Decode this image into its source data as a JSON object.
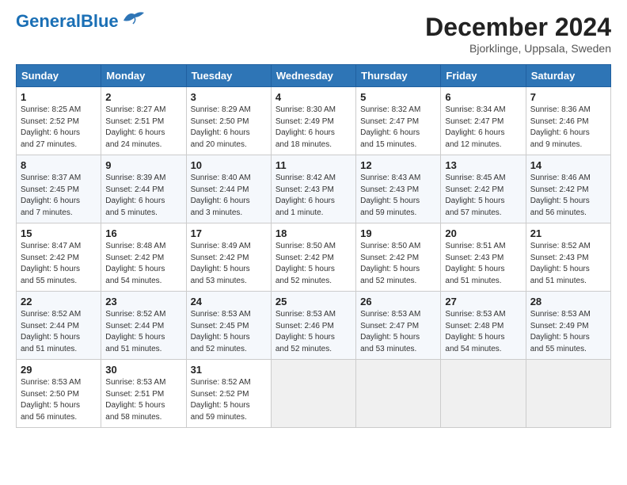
{
  "header": {
    "logo_general": "General",
    "logo_blue": "Blue",
    "title": "December 2024",
    "subtitle": "Bjorklinge, Uppsala, Sweden"
  },
  "calendar": {
    "columns": [
      "Sunday",
      "Monday",
      "Tuesday",
      "Wednesday",
      "Thursday",
      "Friday",
      "Saturday"
    ],
    "weeks": [
      [
        {
          "day": "1",
          "details": "Sunrise: 8:25 AM\nSunset: 2:52 PM\nDaylight: 6 hours\nand 27 minutes."
        },
        {
          "day": "2",
          "details": "Sunrise: 8:27 AM\nSunset: 2:51 PM\nDaylight: 6 hours\nand 24 minutes."
        },
        {
          "day": "3",
          "details": "Sunrise: 8:29 AM\nSunset: 2:50 PM\nDaylight: 6 hours\nand 20 minutes."
        },
        {
          "day": "4",
          "details": "Sunrise: 8:30 AM\nSunset: 2:49 PM\nDaylight: 6 hours\nand 18 minutes."
        },
        {
          "day": "5",
          "details": "Sunrise: 8:32 AM\nSunset: 2:47 PM\nDaylight: 6 hours\nand 15 minutes."
        },
        {
          "day": "6",
          "details": "Sunrise: 8:34 AM\nSunset: 2:47 PM\nDaylight: 6 hours\nand 12 minutes."
        },
        {
          "day": "7",
          "details": "Sunrise: 8:36 AM\nSunset: 2:46 PM\nDaylight: 6 hours\nand 9 minutes."
        }
      ],
      [
        {
          "day": "8",
          "details": "Sunrise: 8:37 AM\nSunset: 2:45 PM\nDaylight: 6 hours\nand 7 minutes."
        },
        {
          "day": "9",
          "details": "Sunrise: 8:39 AM\nSunset: 2:44 PM\nDaylight: 6 hours\nand 5 minutes."
        },
        {
          "day": "10",
          "details": "Sunrise: 8:40 AM\nSunset: 2:44 PM\nDaylight: 6 hours\nand 3 minutes."
        },
        {
          "day": "11",
          "details": "Sunrise: 8:42 AM\nSunset: 2:43 PM\nDaylight: 6 hours\nand 1 minute."
        },
        {
          "day": "12",
          "details": "Sunrise: 8:43 AM\nSunset: 2:43 PM\nDaylight: 5 hours\nand 59 minutes."
        },
        {
          "day": "13",
          "details": "Sunrise: 8:45 AM\nSunset: 2:42 PM\nDaylight: 5 hours\nand 57 minutes."
        },
        {
          "day": "14",
          "details": "Sunrise: 8:46 AM\nSunset: 2:42 PM\nDaylight: 5 hours\nand 56 minutes."
        }
      ],
      [
        {
          "day": "15",
          "details": "Sunrise: 8:47 AM\nSunset: 2:42 PM\nDaylight: 5 hours\nand 55 minutes."
        },
        {
          "day": "16",
          "details": "Sunrise: 8:48 AM\nSunset: 2:42 PM\nDaylight: 5 hours\nand 54 minutes."
        },
        {
          "day": "17",
          "details": "Sunrise: 8:49 AM\nSunset: 2:42 PM\nDaylight: 5 hours\nand 53 minutes."
        },
        {
          "day": "18",
          "details": "Sunrise: 8:50 AM\nSunset: 2:42 PM\nDaylight: 5 hours\nand 52 minutes."
        },
        {
          "day": "19",
          "details": "Sunrise: 8:50 AM\nSunset: 2:42 PM\nDaylight: 5 hours\nand 52 minutes."
        },
        {
          "day": "20",
          "details": "Sunrise: 8:51 AM\nSunset: 2:43 PM\nDaylight: 5 hours\nand 51 minutes."
        },
        {
          "day": "21",
          "details": "Sunrise: 8:52 AM\nSunset: 2:43 PM\nDaylight: 5 hours\nand 51 minutes."
        }
      ],
      [
        {
          "day": "22",
          "details": "Sunrise: 8:52 AM\nSunset: 2:44 PM\nDaylight: 5 hours\nand 51 minutes."
        },
        {
          "day": "23",
          "details": "Sunrise: 8:52 AM\nSunset: 2:44 PM\nDaylight: 5 hours\nand 51 minutes."
        },
        {
          "day": "24",
          "details": "Sunrise: 8:53 AM\nSunset: 2:45 PM\nDaylight: 5 hours\nand 52 minutes."
        },
        {
          "day": "25",
          "details": "Sunrise: 8:53 AM\nSunset: 2:46 PM\nDaylight: 5 hours\nand 52 minutes."
        },
        {
          "day": "26",
          "details": "Sunrise: 8:53 AM\nSunset: 2:47 PM\nDaylight: 5 hours\nand 53 minutes."
        },
        {
          "day": "27",
          "details": "Sunrise: 8:53 AM\nSunset: 2:48 PM\nDaylight: 5 hours\nand 54 minutes."
        },
        {
          "day": "28",
          "details": "Sunrise: 8:53 AM\nSunset: 2:49 PM\nDaylight: 5 hours\nand 55 minutes."
        }
      ],
      [
        {
          "day": "29",
          "details": "Sunrise: 8:53 AM\nSunset: 2:50 PM\nDaylight: 5 hours\nand 56 minutes."
        },
        {
          "day": "30",
          "details": "Sunrise: 8:53 AM\nSunset: 2:51 PM\nDaylight: 5 hours\nand 58 minutes."
        },
        {
          "day": "31",
          "details": "Sunrise: 8:52 AM\nSunset: 2:52 PM\nDaylight: 5 hours\nand 59 minutes."
        },
        {
          "day": "",
          "details": ""
        },
        {
          "day": "",
          "details": ""
        },
        {
          "day": "",
          "details": ""
        },
        {
          "day": "",
          "details": ""
        }
      ]
    ]
  }
}
